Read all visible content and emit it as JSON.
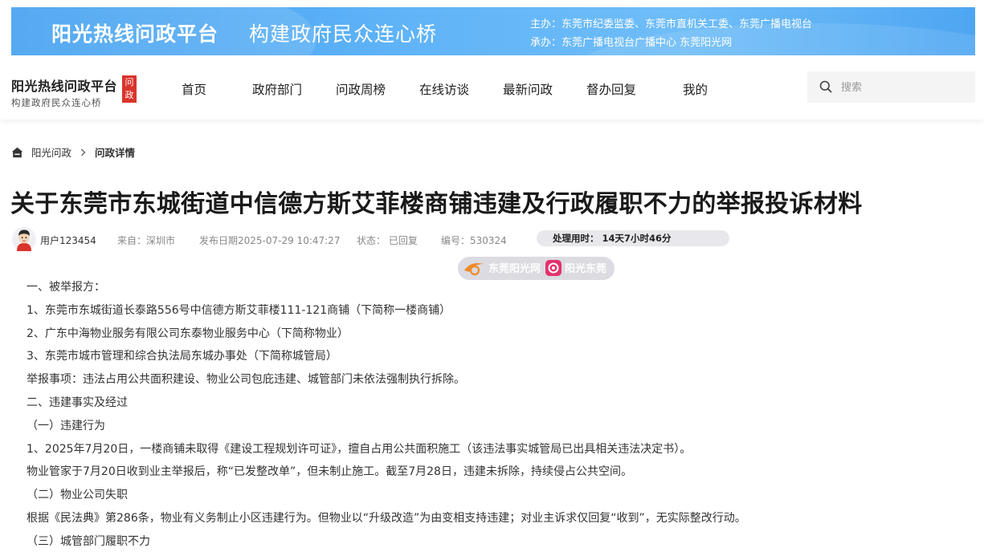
{
  "banner": {
    "title": "阳光热线问政平台",
    "slogan": "构建政府民众连心桥",
    "host": "主办：东莞市纪委监委、东莞市直机关工委、东莞广播电视台",
    "organizer": "承办：东莞广播电视台广播中心 东莞阳光网"
  },
  "logo": {
    "name": "阳光热线问政平台",
    "subtitle": "构建政府民众连心桥",
    "badge_line1": "问",
    "badge_line2": "政"
  },
  "nav": {
    "items": [
      "首页",
      "政府部门",
      "问政周榜",
      "在线访谈",
      "最新问政",
      "督办回复",
      "我的"
    ]
  },
  "search": {
    "placeholder": "搜索",
    "value": ""
  },
  "breadcrumb": {
    "home": "阳光问政",
    "current": "问政详情"
  },
  "article": {
    "title": "关于东莞市东城街道中信德方斯艾菲楼商铺违建及行政履职不力的举报投诉材料",
    "author": "用户123454",
    "source": "来自：深圳市",
    "published": "发布日期2025-07-29 10:47:27",
    "status": "状态：  已回复",
    "number": "编号：530324",
    "duration_label": "处理用时：",
    "duration_value": "14天7小时46分",
    "paragraphs": [
      "一、被举报方：",
      "1、东莞市东城街道长泰路556号中信德方斯艾菲楼111-121商铺（下简称一楼商铺）",
      "2、广东中海物业服务有限公司东泰物业服务中心（下简称物业）",
      "3、东莞市城市管理和综合执法局东城办事处（下简称城管局）",
      "举报事项：违法占用公共面积建设、物业公司包庇违建、城管部门未依法强制执行拆除。",
      "二、违建事实及经过",
      "（一）违建行为",
      "1、2025年7月20日，一楼商铺未取得《建设工程规划许可证》，擅自占用公共面积施工（该违法事实城管局已出具相关违法决定书）。",
      "物业管家于7月20日收到业主举报后，称“已发整改单”，但未制止施工。截至7月28日，违建未拆除，持续侵占公共空间。",
      "（二）物业公司失职",
      "根据《民法典》第286条，物业有义务制止小区违建行为。但物业以“升级改造”为由变相支持违建；对业主诉求仅回复“收到”，无实际整改行动。",
      "（三）城管部门履职不力"
    ]
  },
  "watermark": {
    "text1": "东莞阳光网",
    "text2": "阳光东莞"
  },
  "colors": {
    "banner": "#4ea6f2",
    "badge": "#d9342b",
    "duration_bg": "#e8e8ec"
  },
  "icons": {
    "home": "home-icon",
    "chevron": "chevron-right-icon",
    "search": "search-icon",
    "avatar": "avatar"
  }
}
